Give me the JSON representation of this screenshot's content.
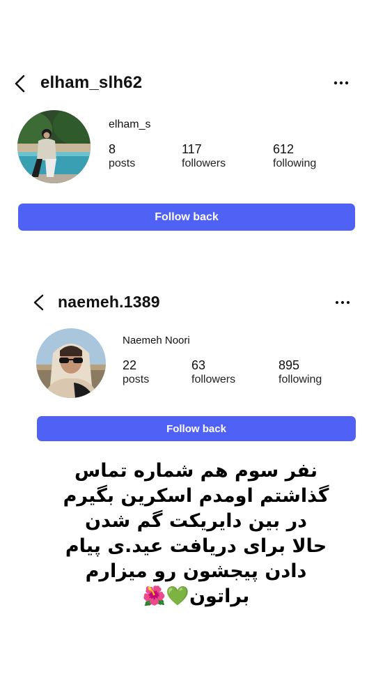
{
  "profiles": [
    {
      "username": "elham_slh62",
      "display_name": "elham_s",
      "stats": [
        {
          "value": "8",
          "label": "posts"
        },
        {
          "value": "117",
          "label": "followers"
        },
        {
          "value": "612",
          "label": "following"
        }
      ],
      "follow_label": "Follow back",
      "icons": {
        "back": "chevron-left-icon",
        "more": "more-horizontal-icon"
      }
    },
    {
      "username": "naemeh.1389",
      "display_name": "Naemeh Noori",
      "stats": [
        {
          "value": "22",
          "label": "posts"
        },
        {
          "value": "63",
          "label": "followers"
        },
        {
          "value": "895",
          "label": "following"
        }
      ],
      "follow_label": "Follow back",
      "icons": {
        "back": "chevron-left-icon",
        "more": "more-horizontal-icon"
      }
    }
  ],
  "caption": {
    "lines": [
      "نفر سوم هم شماره تماس",
      "گذاشتم اومدم اسکرین بگیرم",
      "در بین دایریکت گم شدن",
      "حالا برای دریافت عید.ی پیام",
      "دادن پیجشون رو میزارم",
      "براتون💚🌺"
    ]
  },
  "colors": {
    "accent": "#5061f6",
    "text": "#111111",
    "background": "#ffffff"
  }
}
